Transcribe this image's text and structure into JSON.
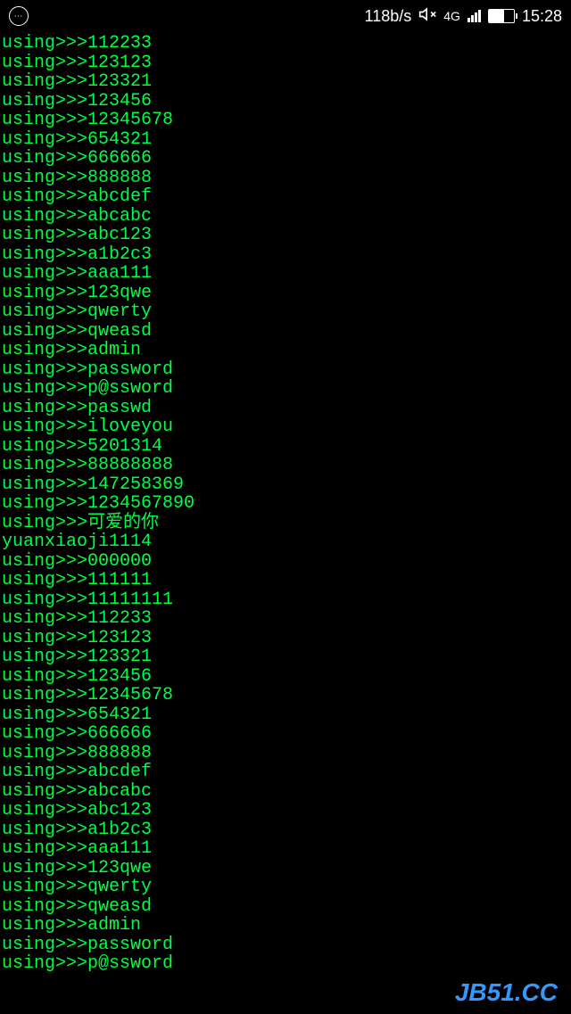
{
  "status_bar": {
    "data_rate": "118b/s",
    "network_type": "4G",
    "time": "15:28"
  },
  "terminal_lines": [
    "using>>>112233",
    "using>>>123123",
    "using>>>123321",
    "using>>>123456",
    "using>>>12345678",
    "using>>>654321",
    "using>>>666666",
    "using>>>888888",
    "using>>>abcdef",
    "using>>>abcabc",
    "using>>>abc123",
    "using>>>a1b2c3",
    "using>>>aaa111",
    "using>>>123qwe",
    "using>>>qwerty",
    "using>>>qweasd",
    "using>>>admin",
    "using>>>password",
    "using>>>p@ssword",
    "using>>>passwd",
    "using>>>iloveyou",
    "using>>>5201314",
    "using>>>88888888",
    "using>>>147258369",
    "using>>>1234567890",
    "using>>>可爱的你",
    "yuanxiaoji1114",
    "using>>>000000",
    "using>>>111111",
    "using>>>11111111",
    "using>>>112233",
    "using>>>123123",
    "using>>>123321",
    "using>>>123456",
    "using>>>12345678",
    "using>>>654321",
    "using>>>666666",
    "using>>>888888",
    "using>>>abcdef",
    "using>>>abcabc",
    "using>>>abc123",
    "using>>>a1b2c3",
    "using>>>aaa111",
    "using>>>123qwe",
    "using>>>qwerty",
    "using>>>qweasd",
    "using>>>admin",
    "using>>>password",
    "using>>>p@ssword"
  ],
  "watermark": "JB51.CC"
}
